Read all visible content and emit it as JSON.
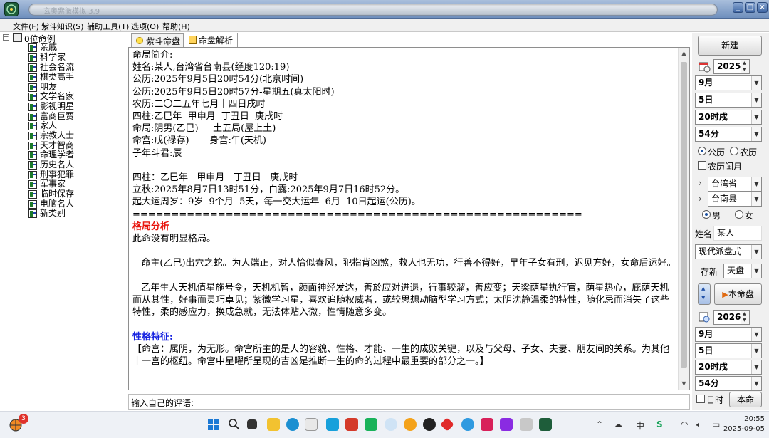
{
  "window": {
    "title": "玄奥紫微模拟 3.9",
    "buttons": [
      "_",
      "□",
      "×"
    ]
  },
  "menu": [
    "文件(F)",
    "紫斗知识(S)",
    "辅助工具(T)",
    "选项(O)",
    "帮助(H)"
  ],
  "tree": {
    "root_label": "0位命例",
    "items": [
      "亲戚",
      "科学家",
      "社会名流",
      "棋类高手",
      "朋友",
      "文学名家",
      "影视明星",
      "富商巨贾",
      "家人",
      "宗教人士",
      "天才智商",
      "命理学者",
      "历史名人",
      "刑事犯罪",
      "军事家",
      "临时保存",
      "电脑名人",
      "新类别"
    ]
  },
  "tabs": [
    "紫斗命盘",
    "命盘解析"
  ],
  "content": {
    "intro_lines": [
      "命局简介:",
      "姓名:某人,台湾省台南县(经度120:19)",
      "公历:2025年9月5日20时54分(北京时间)",
      "公历:2025年9月5日20时57分-星期五(真太阳时)",
      "农历:二〇二五年七月十四日戌时",
      "四柱:乙巳年  甲申月  丁丑日  庚戌时",
      "命局:阴男(乙巳)     土五局(屋上土)",
      "命宫:戌(禄存)       身宫:午(天机)",
      "子年斗君:辰",
      "",
      "四柱：乙巳年   甲申月   丁丑日   庚戌时",
      "立秋:2025年8月7日13时51分，白露:2025年9月7日16时52分。",
      "起大运周岁：9岁  9个月  5天，每一交大运年  6月  10日起运(公历)。",
      "=========================================================="
    ],
    "pattern_title": "格局分析",
    "pattern_text": "此命没有明显格局。",
    "para1": "   命主(乙巳)出穴之蛇。为人端正，对人恰似春风，犯指背凶煞，救人也无功，行善不得好，早年子女有刑，迟见方好，女命后运好。",
    "para2": "   乙年生人天机值星施号令，天机机智，颜面神经发达，善於应对进退，行事较溜，善应变；天梁荫星执行官，荫星热心，庇荫天机而从其性，好事而灵巧卓见；紫微学习星，喜欢追随权威者，或较思想动脑型学习方式；太阴沈静温柔的特性，随化忌而消失了这些特性，柔的感应力，换成急就，无法体贴入微，性情随意多变。",
    "trait_title": "性格特征:",
    "trait_text": "【命宫：属阴，为无形。命宫所主的是人的容貌、性格、才能、一生的成败关键，以及与父母、子女、夫妻、朋友间的关系。为其他十一宫的枢纽。命宫中星曜所呈现的吉凶是推断一生的命的过程中最重要的部分之一。】"
  },
  "comment": {
    "label": "输入自己的评语:"
  },
  "right_panel": {
    "new_button": "新建",
    "year1": "2025",
    "month1": "9月",
    "day1": "5日",
    "hour1": "20时戌",
    "minute1": "54分",
    "calendar_solar": "公历",
    "calendar_lunar": "农历",
    "leap_month": "农历闰月",
    "province": "台湾省",
    "county": "台南县",
    "male": "男",
    "female": "女",
    "name_label": "姓名",
    "name_value": "某人",
    "school": "现代派盘式",
    "save_label": "存新",
    "save_value": "天盘",
    "this_chart_button": "本命盘",
    "year2": "2026",
    "month2": "9月",
    "day2": "5日",
    "hour2": "20时戌",
    "minute2": "54分",
    "day_hour": "日时",
    "benming_button": "本命"
  },
  "taskbar": {
    "notification_count": "3",
    "tray_ime": "中",
    "time": "20:55",
    "date": "2025-09-05"
  },
  "colors": {
    "accent_red": "#e8140c",
    "accent_blue": "#1521e0",
    "titlebar": "#6f8fbd"
  }
}
